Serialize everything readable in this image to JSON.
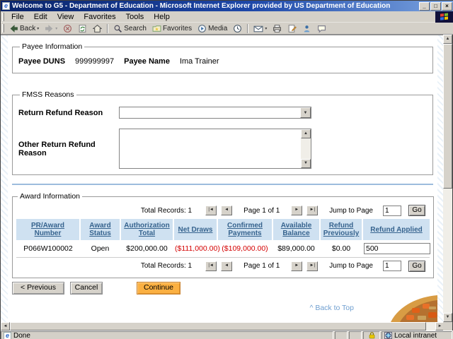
{
  "window": {
    "title": "Welcome to G5 - Department of Education - Microsoft Internet Explorer provided by US Department of Education"
  },
  "glyphs": {
    "minimize": "_",
    "maximize": "□",
    "close": "×",
    "dropdown": "▾",
    "page_first": "|◄",
    "page_prev": "◄",
    "page_next": "►",
    "page_last": "►|",
    "up": "▲",
    "down": "▼",
    "left": "◄",
    "right": "►",
    "ie": "e"
  },
  "menu": {
    "items": [
      "File",
      "Edit",
      "View",
      "Favorites",
      "Tools",
      "Help"
    ]
  },
  "toolbar": {
    "back": "Back",
    "search": "Search",
    "favorites": "Favorites",
    "media": "Media"
  },
  "page": {
    "payee": {
      "legend": "Payee Information",
      "duns_label": "Payee DUNS",
      "duns_value": "999999997",
      "name_label": "Payee Name",
      "name_value": "Ima Trainer"
    },
    "fmss": {
      "legend": "FMSS Reasons",
      "return_label": "Return Refund Reason",
      "return_value": "",
      "other_label": "Other Return Refund Reason",
      "other_value": ""
    },
    "award": {
      "legend": "Award Information",
      "pagination": {
        "total_records": "Total Records: 1",
        "page": "Page 1 of 1",
        "jump_label": "Jump to Page",
        "jump_value": "1",
        "go": "Go"
      },
      "table": {
        "headers": [
          "PR/Award Number",
          "Award Status",
          "Authorization Total",
          "Net Draws",
          "Confirmed Payments",
          "Available Balance",
          "Refund Previously",
          "Refund Applied"
        ],
        "row": {
          "pr_award_number": "P066W100002",
          "award_status": "Open",
          "authorization_total": "$200,000.00",
          "net_draws": "($111,000.00)",
          "confirmed_payments": "($109,000.00)",
          "available_balance": "$89,000.00",
          "refund_previously": "$0.00",
          "refund_applied": "500"
        }
      }
    },
    "actions": {
      "previous": "< Previous",
      "cancel": "Cancel",
      "continue": "Continue"
    },
    "back_to_top": "^ Back to Top"
  },
  "statusbar": {
    "status": "Done",
    "zone": "Local intranet"
  },
  "colors": {
    "titlebar_start": "#0a246a",
    "titlebar_end": "#7ba4e0",
    "chrome": "#d4d0c8",
    "table_header_bg": "#cfe1f1",
    "header_link": "#36638e",
    "negative": "#d40000",
    "continue_bg": "#fbb042",
    "continue_border": "#c9802a",
    "divider": "#9dbcdd",
    "back_to_top_link": "#6f9fd0"
  }
}
